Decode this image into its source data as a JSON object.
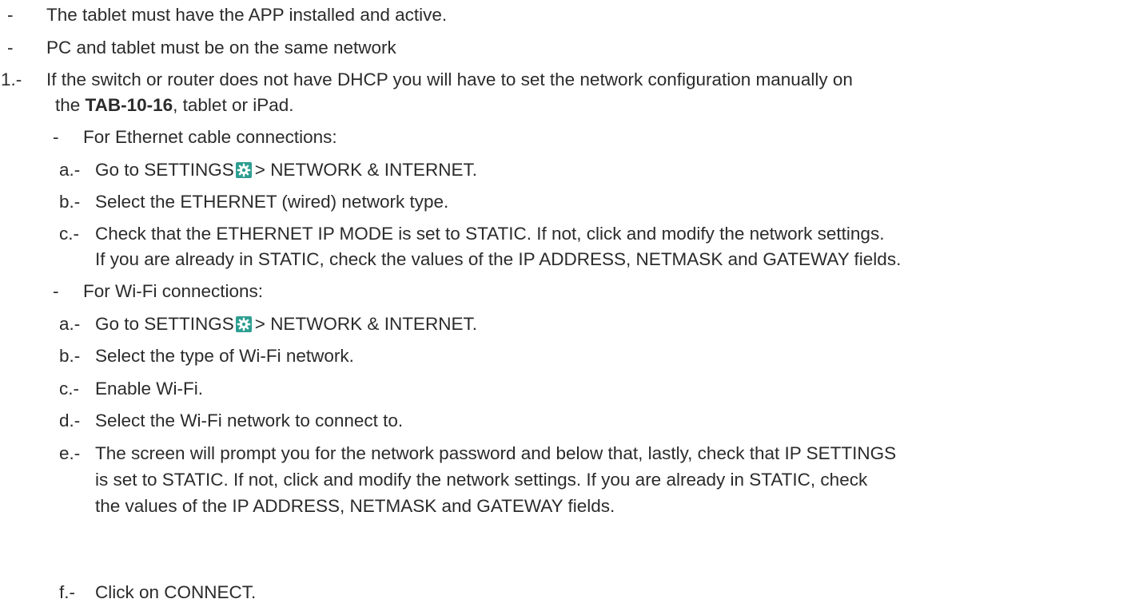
{
  "intro": [
    {
      "marker": "-",
      "text": "The tablet must have the APP installed and active."
    },
    {
      "marker": "-",
      "text": "PC and tablet must be on the same network"
    }
  ],
  "step1": {
    "marker": "1.-",
    "text_line1": "If the switch or router does not have DHCP you will have to set the network configuration manually on",
    "text_line2_pre": "the ",
    "text_line2_bold": "TAB-10-16",
    "text_line2_post": ", tablet or  iPad."
  },
  "ethernet": {
    "marker": "-",
    "heading": "For Ethernet cable connections:",
    "items": [
      {
        "marker": "a.-",
        "pre": "Go to SETTINGS",
        "post": "> NETWORK & INTERNET."
      },
      {
        "marker": "b.-",
        "text": "Select the ETHERNET (wired) network type."
      },
      {
        "marker": "c.-",
        "line1": "Check that the ETHERNET IP MODE is set to STATIC. If not, click and modify the network settings.",
        "line2": "If you are already in STATIC, check the values of the IP ADDRESS, NETMASK and GATEWAY fields."
      }
    ]
  },
  "wifi": {
    "marker": "-",
    "heading": "For Wi-Fi connections:",
    "items": [
      {
        "marker": "a.-",
        "pre": "Go to SETTINGS",
        "post": "> NETWORK & INTERNET."
      },
      {
        "marker": "b.-",
        "text": "Select the type of Wi-Fi network."
      },
      {
        "marker": "c.-",
        "text": "Enable Wi-Fi."
      },
      {
        "marker": "d.-",
        "text": "Select the Wi-Fi network to connect to."
      },
      {
        "marker": "e.-",
        "line1": "The screen will prompt you for the network password and below that, lastly, check that IP SETTINGS",
        "line2": "is set to STATIC. If not, click and modify the network settings. If you are already in STATIC, check",
        "line3": "the values of the IP ADDRESS, NETMASK and GATEWAY fields."
      },
      {
        "marker": "f.-",
        "text": "Click on CONNECT."
      }
    ]
  },
  "icon": {
    "name": "settings-gear-icon",
    "bg": "#2e9e92",
    "fg": "#ffffff"
  }
}
